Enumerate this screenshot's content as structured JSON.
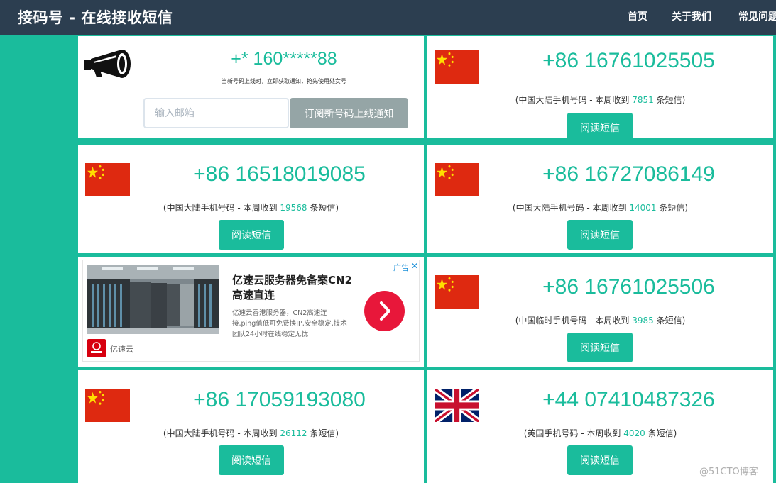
{
  "header": {
    "brand": "接码号 - 在线接收短信",
    "nav": [
      "首页",
      "关于我们",
      "常见问题"
    ]
  },
  "subscribe": {
    "number": "+* 160*****88",
    "hint": "当新号码上线时，立即获取通知，抢先使用处女号",
    "email_placeholder": "输入邮箱",
    "button": "订阅新号码上线通知"
  },
  "phones": [
    {
      "number": "+86 16761025505",
      "desc_prefix": "(中国大陆手机号码 - 本周收到 ",
      "count": "7851",
      "desc_suffix": " 条短信)",
      "button": "阅读短信",
      "flag": "china-flag-icon"
    },
    {
      "number": "+86 16518019085",
      "desc_prefix": "(中国大陆手机号码 - 本周收到 ",
      "count": "19568",
      "desc_suffix": " 条短信)",
      "button": "阅读短信",
      "flag": "china-flag-icon"
    },
    {
      "number": "+86 16727086149",
      "desc_prefix": "(中国大陆手机号码 - 本周收到 ",
      "count": "14001",
      "desc_suffix": " 条短信)",
      "button": "阅读短信",
      "flag": "china-flag-icon"
    },
    {
      "number": "+86 16761025506",
      "desc_prefix": "(中国临时手机号码 - 本周收到 ",
      "count": "3985",
      "desc_suffix": " 条短信)",
      "button": "阅读短信",
      "flag": "china-flag-icon"
    },
    {
      "number": "+86 17059193080",
      "desc_prefix": "(中国大陆手机号码 - 本周收到 ",
      "count": "26112",
      "desc_suffix": " 条短信)",
      "button": "阅读短信",
      "flag": "china-flag-icon"
    },
    {
      "number": "+44 07410487326",
      "desc_prefix": "(英国手机号码 - 本周收到 ",
      "count": "4020",
      "desc_suffix": " 条短信)",
      "button": "阅读短信",
      "flag": "uk-flag-icon"
    }
  ],
  "ad": {
    "tag": "广告",
    "close": "✕",
    "title": "亿速云服务器免备案CN2高速直连",
    "body": "亿速云香港服务器，CN2高速连接,ping值低可免费换IP,安全稳定,技术团队24小时在线稳定无忧",
    "brand": "亿速云"
  },
  "watermark": "@51CTO博客",
  "colors": {
    "accent": "#1abc9c",
    "navbar": "#2c3e50",
    "muted_button": "#95a5a6",
    "ad_button": "#e8173a"
  }
}
